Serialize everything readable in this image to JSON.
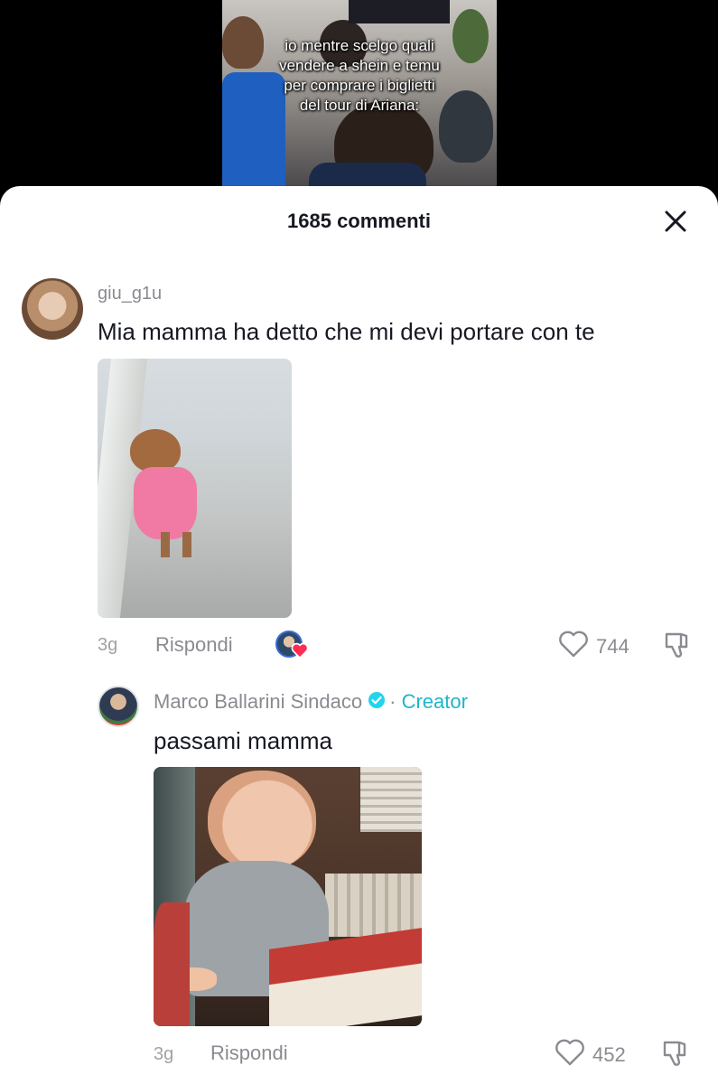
{
  "video": {
    "caption": "io mentre scelgo quali\nvendere a shein e temu\nper comprare i biglietti\ndel tour di Ariana:"
  },
  "sheet": {
    "title": "1685 commenti",
    "close_icon": "close-icon"
  },
  "comments": [
    {
      "username": "giu_g1u",
      "text": "Mia mamma ha detto che mi devi portare con te",
      "time": "3g",
      "reply_label": "Rispondi",
      "likes": "744",
      "media": "gif-dog-pink-dress"
    },
    {
      "username": "Marco Ballarini Sindaco",
      "separator": "·",
      "badge": "Creator",
      "text": "passami mamma",
      "time": "3g",
      "reply_label": "Rispondi",
      "likes": "452",
      "media": "gif-toddler-at-table"
    }
  ],
  "colors": {
    "accent": "#20b5c9",
    "verified": "#20d5ec",
    "like_heart": "#fe2c55",
    "muted": "#8a8b91"
  }
}
